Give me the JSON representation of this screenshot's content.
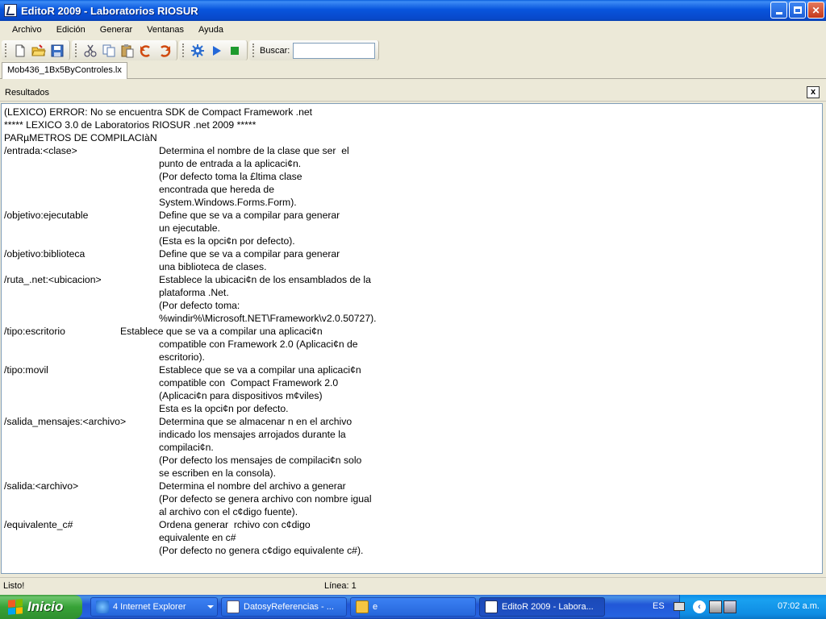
{
  "window": {
    "title": "EditoR 2009 - Laboratorios RIOSUR"
  },
  "menu": [
    "Archivo",
    "Edición",
    "Generar",
    "Ventanas",
    "Ayuda"
  ],
  "toolbar": {
    "search_label": "Buscar:",
    "search_value": "",
    "icons": [
      "new-file-icon",
      "open-folder-icon",
      "save-icon",
      "cut-icon",
      "copy-icon",
      "paste-icon",
      "undo-icon",
      "redo-icon",
      "settings-gear-icon",
      "run-play-icon",
      "stop-icon"
    ]
  },
  "tabs": [
    {
      "label": "Mob436_1Bx5ByControles.lx"
    }
  ],
  "results": {
    "title": "Resultados",
    "close_label": "x",
    "lines": [
      {
        "key": "(LEXICO) ERROR: No se encuentra SDK de Compact Framework .net",
        "desc": ""
      },
      {
        "key": "***** LEXICO 3.0 de Laboratorios RIOSUR .net 2009 *****",
        "desc": ""
      },
      {
        "key": "PARµMETROS DE COMPILACIàN",
        "desc": ""
      },
      {
        "key": "/entrada:<clase>",
        "desc": "Determina el nombre de la clase que ser  el"
      },
      {
        "key": "",
        "desc": "punto de entrada a la aplicaci¢n."
      },
      {
        "key": "",
        "desc": "(Por defecto toma la £ltima clase"
      },
      {
        "key": "",
        "desc": "encontrada que hereda de"
      },
      {
        "key": "",
        "desc": "System.Windows.Forms.Form)."
      },
      {
        "key": "/objetivo:ejecutable",
        "desc": "Define que se va a compilar para generar"
      },
      {
        "key": "",
        "desc": "un ejecutable."
      },
      {
        "key": "",
        "desc": "(Esta es la opci¢n por defecto)."
      },
      {
        "key": "/objetivo:biblioteca",
        "desc": "Define que se va a compilar para generar"
      },
      {
        "key": "",
        "desc": "una biblioteca de clases."
      },
      {
        "key": "/ruta_.net:<ubicacion>",
        "desc": "Establece la ubicaci¢n de los ensamblados de la"
      },
      {
        "key": "",
        "desc": "plataforma .Net."
      },
      {
        "key": "",
        "desc": "(Por defecto toma:"
      },
      {
        "key": "",
        "desc": "%windir%\\Microsoft.NET\\Framework\\v2.0.50727)."
      },
      {
        "key": "/tipo:escritorio",
        "desc": "Establece que se va a compilar una aplicaci¢n",
        "alt": true
      },
      {
        "key": "",
        "desc": "compatible con Framework 2.0 (Aplicaci¢n de"
      },
      {
        "key": "",
        "desc": "escritorio)."
      },
      {
        "key": "/tipo:movil",
        "desc": "Establece que se va a compilar una aplicaci¢n"
      },
      {
        "key": "",
        "desc": "compatible con  Compact Framework 2.0"
      },
      {
        "key": "",
        "desc": "(Aplicaci¢n para dispositivos m¢viles)"
      },
      {
        "key": "",
        "desc": "Esta es la opci¢n por defecto."
      },
      {
        "key": "/salida_mensajes:<archivo>",
        "desc": "Determina que se almacenar n en el archivo"
      },
      {
        "key": "",
        "desc": "indicado los mensajes arrojados durante la"
      },
      {
        "key": "",
        "desc": "compilaci¢n."
      },
      {
        "key": "",
        "desc": "(Por defecto los mensajes de compilaci¢n solo"
      },
      {
        "key": "",
        "desc": "se escriben en la consola)."
      },
      {
        "key": "/salida:<archivo>",
        "desc": "Determina el nombre del archivo a generar"
      },
      {
        "key": "",
        "desc": "(Por defecto se genera archivo con nombre igual"
      },
      {
        "key": "",
        "desc": "al archivo con el c¢digo fuente)."
      },
      {
        "key": "/equivalente_c#",
        "desc": "Ordena generar  rchivo con c¢digo"
      },
      {
        "key": "",
        "desc": "equivalente en c#"
      },
      {
        "key": "",
        "desc": "(Por defecto no genera c¢digo equivalente c#)."
      }
    ]
  },
  "status": {
    "left": "Listo!",
    "line": "Línea: 1"
  },
  "taskbar": {
    "start_label": "Inicio",
    "tasks": [
      {
        "label": "4 Internet Explorer",
        "icon": "internet-explorer-icon",
        "group": true,
        "active": false
      },
      {
        "label": "DatosyReferencias - ...",
        "icon": "document-icon",
        "group": false,
        "active": false
      },
      {
        "label": "e",
        "icon": "folder-icon",
        "group": false,
        "active": false
      },
      {
        "label": "EditoR 2009 - Labora...",
        "icon": "editor-app-icon",
        "group": false,
        "active": true
      }
    ],
    "language": "ES",
    "clock": "07:02 a.m."
  }
}
